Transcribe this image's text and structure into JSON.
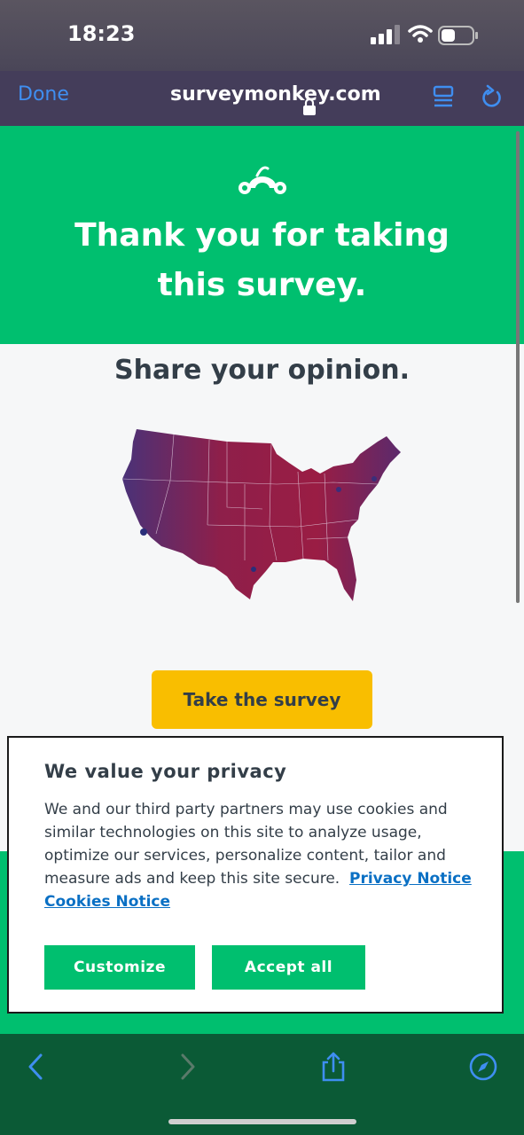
{
  "status_bar": {
    "time": "18:23"
  },
  "browser": {
    "done_label": "Done",
    "url": "surveymonkey.com"
  },
  "page": {
    "hero_title": "Thank you for taking this survey.",
    "share_heading": "Share your opinion.",
    "take_survey_label": "Take the survey"
  },
  "privacy": {
    "title": "We value your privacy",
    "body": "We and our third party partners may use cookies and similar technologies on this site to analyze usage, optimize our services, personalize content, tailor and measure ads and keep this site secure.",
    "privacy_link": "Privacy Notice",
    "cookies_link": "Cookies Notice",
    "customize_label": "Customize",
    "accept_label": "Accept all"
  },
  "colors": {
    "brand_green": "#00bf6f",
    "cta_yellow": "#f9be00",
    "link_blue": "#0a70c4",
    "ios_blue": "#3f8ef0"
  },
  "icons": [
    "lock-icon",
    "reader-icon",
    "reload-icon",
    "surveymonkey-logo",
    "back-icon",
    "forward-icon",
    "share-icon",
    "compass-icon"
  ]
}
